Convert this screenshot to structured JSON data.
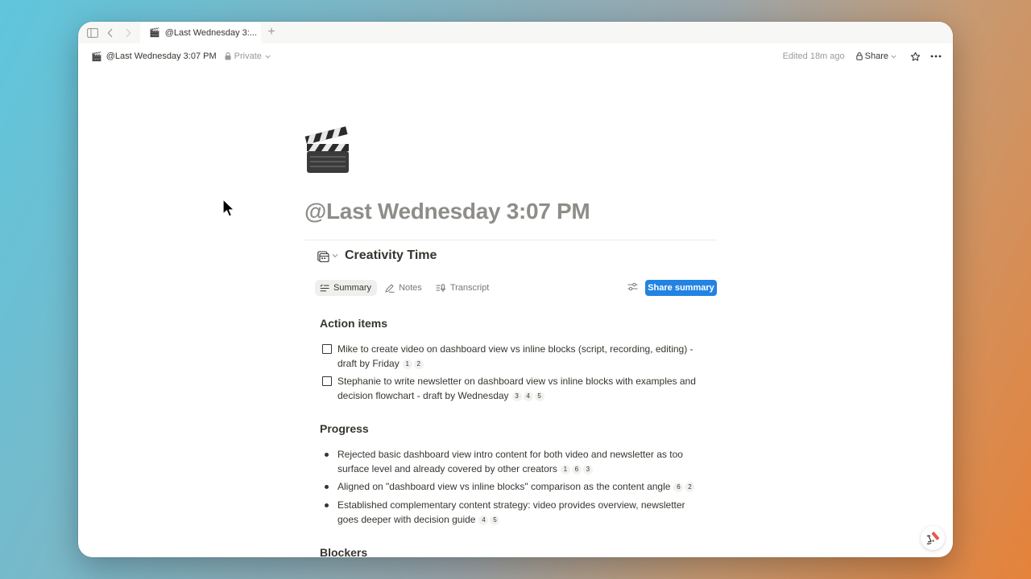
{
  "tab": {
    "title": "@Last Wednesday 3:..."
  },
  "topbar": {
    "breadcrumb": "@Last Wednesday 3:07 PM",
    "privacy": "Private",
    "edited": "Edited 18m ago",
    "share": "Share"
  },
  "page": {
    "icon": "clapper-board-icon",
    "title": "@Last Wednesday 3:07 PM"
  },
  "meeting": {
    "title": "Creativity Time",
    "tabs": [
      {
        "label": "Summary",
        "icon": "summary-list-icon",
        "active": true
      },
      {
        "label": "Notes",
        "icon": "pencil-icon",
        "active": false
      },
      {
        "label": "Transcript",
        "icon": "microphone-icon",
        "active": false
      }
    ],
    "share_summary": "Share summary"
  },
  "sections": {
    "action_items": {
      "title": "Action items",
      "items": [
        {
          "text": "Mike to create video on dashboard view vs inline blocks (script, recording, editing) - draft by Friday",
          "refs": [
            "1",
            "2"
          ],
          "checked": false
        },
        {
          "text": "Stephanie to write newsletter on dashboard view vs inline blocks with examples and decision flowchart - draft by Wednesday",
          "refs": [
            "3",
            "4",
            "5"
          ],
          "checked": false
        }
      ]
    },
    "progress": {
      "title": "Progress",
      "items": [
        {
          "text": "Rejected basic dashboard view intro content for both video and newsletter as too surface level and already covered by other creators",
          "refs": [
            "1",
            "6",
            "3"
          ]
        },
        {
          "text": "Aligned on \"dashboard view vs inline blocks\" comparison as the content angle",
          "refs": [
            "6",
            "2"
          ]
        },
        {
          "text": "Established complementary content strategy: video provides overview, newsletter goes deeper with decision guide",
          "refs": [
            "4",
            "5"
          ]
        }
      ]
    },
    "blockers": {
      "title": "Blockers"
    }
  },
  "colors": {
    "accent": "#2383e2",
    "text": "#37352f",
    "muted": "#9b9a97"
  }
}
